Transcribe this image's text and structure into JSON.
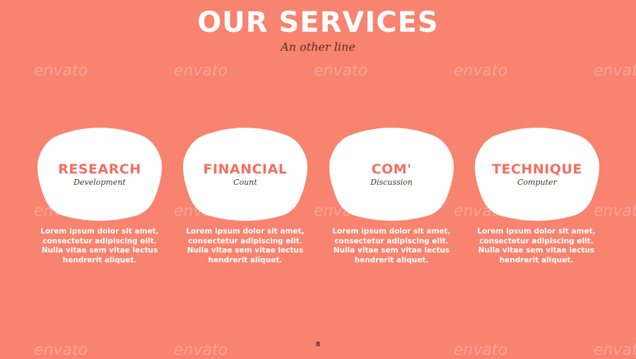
{
  "title": "OUR SERVICES",
  "subtitle": "An other line",
  "watermark": "envato",
  "page_number": "8",
  "colors": {
    "background": "#f8836f",
    "card_fill": "#ffffff",
    "card_title": "#f26f62",
    "card_subtitle": "#4a2e2a"
  },
  "services": [
    {
      "title": "RESEARCH",
      "subtitle": "Development",
      "desc": [
        "Lorem ipsum dolor sit amet,",
        "consectetur adipiscing elit.",
        "Nulla vitae sem vitae lectus",
        "hendrerit aliquet."
      ]
    },
    {
      "title": "FINANCIAL",
      "subtitle": "Count",
      "desc": [
        "Lorem ipsum dolor sit amet,",
        "consectetur adipiscing elit.",
        "Nulla vitae sem vitae lectus",
        "hendrerit aliquet."
      ]
    },
    {
      "title": "COM'",
      "subtitle": "Discussion",
      "desc": [
        "Lorem ipsum dolor sit amet,",
        "consectetur adipiscing elit.",
        "Nulla vitae sem vitae lectus",
        "hendrerit aliquet."
      ]
    },
    {
      "title": "TECHNIQUE",
      "subtitle": "Computer",
      "desc": [
        "Lorem ipsum dolor sit amet,",
        "consectetur adipiscing elit.",
        "Nulla vitae sem vitae lectus",
        "hendrerit aliquet."
      ]
    }
  ]
}
